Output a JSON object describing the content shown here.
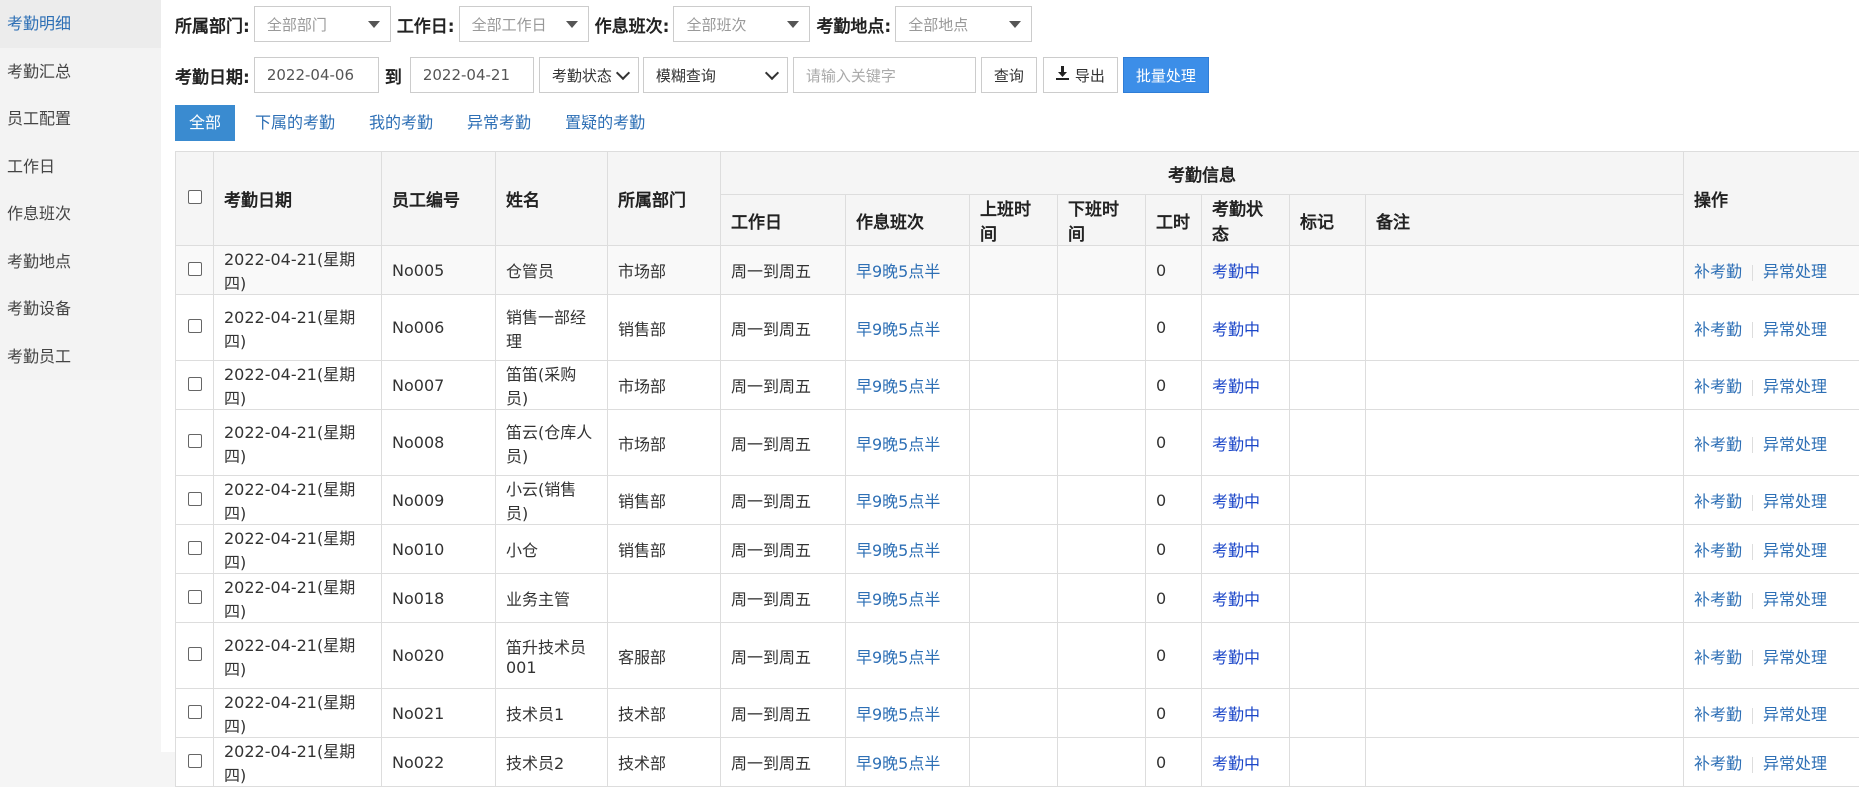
{
  "sidebar": {
    "items": [
      {
        "label": "考勤明细"
      },
      {
        "label": "考勤汇总"
      },
      {
        "label": "员工配置"
      },
      {
        "label": "工作日"
      },
      {
        "label": "作息班次"
      },
      {
        "label": "考勤地点"
      },
      {
        "label": "考勤设备"
      },
      {
        "label": "考勤员工"
      }
    ]
  },
  "filters": {
    "dept_label": "所属部门:",
    "dept_value": "全部部门",
    "workday_label": "工作日:",
    "workday_value": "全部工作日",
    "shift_label": "作息班次:",
    "shift_value": "全部班次",
    "location_label": "考勤地点:",
    "location_value": "全部地点",
    "date_label": "考勤日期:",
    "date_from": "2022-04-06",
    "to_label": "到",
    "date_to": "2022-04-21",
    "status_value": "考勤状态",
    "mode_value": "模糊查询",
    "keyword_placeholder": "请输入关键字",
    "query_label": "查询",
    "export_label": "导出",
    "batch_label": "批量处理"
  },
  "tabs": [
    {
      "label": "全部"
    },
    {
      "label": "下属的考勤"
    },
    {
      "label": "我的考勤"
    },
    {
      "label": "异常考勤"
    },
    {
      "label": "置疑的考勤"
    }
  ],
  "table": {
    "headers": {
      "date": "考勤日期",
      "emp_no": "员工编号",
      "name": "姓名",
      "dept": "所属部门",
      "group": "考勤信息",
      "ops": "操作",
      "workday": "工作日",
      "shift": "作息班次",
      "on_time": "上班时间",
      "off_time": "下班时间",
      "hours": "工时",
      "status": "考勤状态",
      "mark": "标记",
      "remark": "备注"
    },
    "op1": "补考勤",
    "op2": "异常处理",
    "rows": [
      {
        "date": "2022-04-21(星期四)",
        "emp_no": "No005",
        "name": "仓管员",
        "dept": "市场部",
        "workday": "周一到周五",
        "shift": "早9晚5点半",
        "hours": "0",
        "status": "考勤中"
      },
      {
        "date": "2022-04-21(星期四)",
        "emp_no": "No006",
        "name": "销售一部经理",
        "dept": "销售部",
        "workday": "周一到周五",
        "shift": "早9晚5点半",
        "hours": "0",
        "status": "考勤中"
      },
      {
        "date": "2022-04-21(星期四)",
        "emp_no": "No007",
        "name": "笛笛(采购员)",
        "dept": "市场部",
        "workday": "周一到周五",
        "shift": "早9晚5点半",
        "hours": "0",
        "status": "考勤中"
      },
      {
        "date": "2022-04-21(星期四)",
        "emp_no": "No008",
        "name": "笛云(仓库人员)",
        "dept": "市场部",
        "workday": "周一到周五",
        "shift": "早9晚5点半",
        "hours": "0",
        "status": "考勤中"
      },
      {
        "date": "2022-04-21(星期四)",
        "emp_no": "No009",
        "name": "小云(销售员)",
        "dept": "销售部",
        "workday": "周一到周五",
        "shift": "早9晚5点半",
        "hours": "0",
        "status": "考勤中"
      },
      {
        "date": "2022-04-21(星期四)",
        "emp_no": "No010",
        "name": "小仓",
        "dept": "销售部",
        "workday": "周一到周五",
        "shift": "早9晚5点半",
        "hours": "0",
        "status": "考勤中"
      },
      {
        "date": "2022-04-21(星期四)",
        "emp_no": "No018",
        "name": "业务主管",
        "dept": "",
        "workday": "周一到周五",
        "shift": "早9晚5点半",
        "hours": "0",
        "status": "考勤中"
      },
      {
        "date": "2022-04-21(星期四)",
        "emp_no": "No020",
        "name": "笛升技术员001",
        "dept": "客服部",
        "workday": "周一到周五",
        "shift": "早9晚5点半",
        "hours": "0",
        "status": "考勤中"
      },
      {
        "date": "2022-04-21(星期四)",
        "emp_no": "No021",
        "name": "技术员1",
        "dept": "技术部",
        "workday": "周一到周五",
        "shift": "早9晚5点半",
        "hours": "0",
        "status": "考勤中"
      },
      {
        "date": "2022-04-21(星期四)",
        "emp_no": "No022",
        "name": "技术员2",
        "dept": "技术部",
        "workday": "周一到周五",
        "shift": "早9晚5点半",
        "hours": "0",
        "status": "考勤中"
      }
    ]
  }
}
